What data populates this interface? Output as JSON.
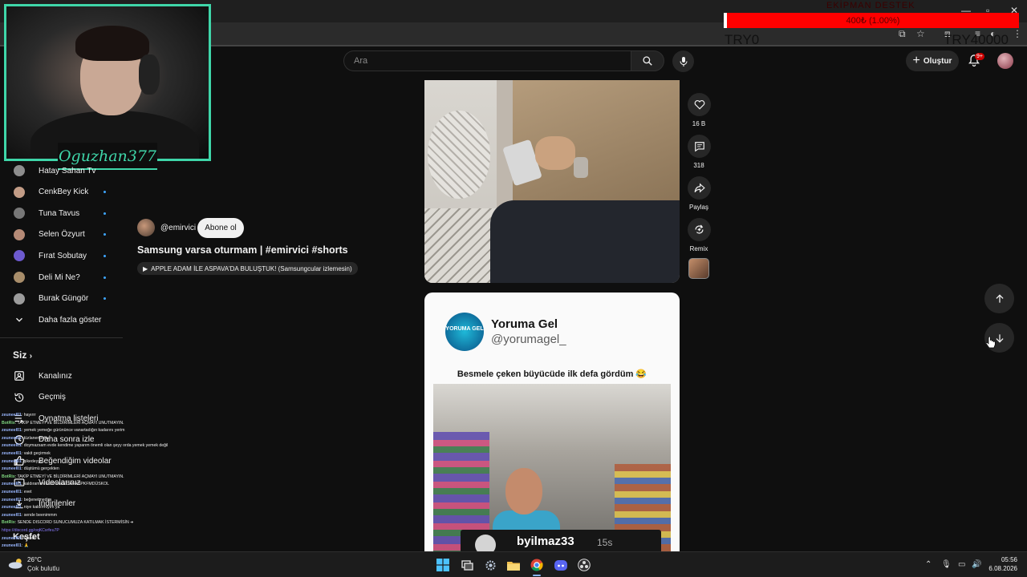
{
  "donation": {
    "title": "EKİPMAN DESTEK",
    "progress_text": "400₺ (1.00%)",
    "progress_fraction": 0.01,
    "min_label": "TRY0",
    "max_label": "TRY40000",
    "bar_color": "#ff0000"
  },
  "webcam": {
    "streamer_name": "Oguzhan377",
    "border_color": "#3fd6a9"
  },
  "header": {
    "search_placeholder": "Ara",
    "create_label": "Oluştur",
    "notification_count": "9+"
  },
  "sidebar": {
    "subscriptions": [
      {
        "label": "Hatay Sahan Tv",
        "avatar_color": "#8d8d8d"
      },
      {
        "label": "CenkBey Kick",
        "avatar_color": "#c29c86"
      },
      {
        "label": "Tuna Tavus",
        "avatar_color": "#777777"
      },
      {
        "label": "Selen Özyurt",
        "avatar_color": "#b58a76"
      },
      {
        "label": "Fırat Sobutay",
        "avatar_color": "#6d5acf"
      },
      {
        "label": "Deli Mi Ne?",
        "avatar_color": "#a88d6a"
      },
      {
        "label": "Burak Güngör",
        "avatar_color": "#9c9c9c"
      }
    ],
    "show_more_label": "Daha fazla göster",
    "you_section_label": "Siz",
    "you_items": [
      {
        "label": "Kanalınız",
        "icon": "channel-icon"
      },
      {
        "label": "Geçmiş",
        "icon": "history-icon"
      },
      {
        "label": "Oynatma listeleri",
        "icon": "playlist-icon"
      },
      {
        "label": "Daha sonra izle",
        "icon": "clock-icon"
      },
      {
        "label": "Beğendiğim videolar",
        "icon": "like-icon"
      },
      {
        "label": "Videolarınız",
        "icon": "video-icon"
      },
      {
        "label": "İndirilenler",
        "icon": "download-icon"
      }
    ],
    "explore_label": "Keşfet"
  },
  "chat": {
    "messages": [
      {
        "user": "zeuneel01",
        "text": ": hayırrr",
        "bot": false
      },
      {
        "user": "BotRix",
        "text": ": TAKİP ETMEYİ VE BİLDİRİMLERİ AÇMAYI UNUTMAYIN.",
        "bot": true
      },
      {
        "user": "zeuneel01",
        "text": ": yemek yemeğe gürününce vanartadığın kadarını yerim",
        "bot": false
      },
      {
        "user": "zeuneel01",
        "text": ": tüzlanenpuftu",
        "bot": false
      },
      {
        "user": "zeuneel01",
        "text": ": doymazsam evde kendime yaparım önemli olan şeyy orda yemek yemek değil",
        "bot": false
      },
      {
        "user": "zeuneel01",
        "text": ": vakit geçirmek",
        "bot": false
      },
      {
        "user": "zeuneel01",
        "text": ": şikedeyyy",
        "bot": false
      },
      {
        "user": "zeuneel01",
        "text": ": düştümü gerçekten",
        "bot": false
      },
      {
        "user": "BotRix",
        "text": ": TAKİP ETMEYİ VE BİLDİRİMLERİ AÇMAYI UNUTMAYIN.",
        "bot": true
      },
      {
        "user": "zeuneel01",
        "text": ": kaldıramım ki siz bana DAFAOPKFMDÜSKOL",
        "bot": false
      },
      {
        "user": "zeuneel01",
        "text": ": evet",
        "bot": false
      },
      {
        "user": "zeuneel01",
        "text": ": beğenetmedim",
        "bot": false
      },
      {
        "user": "zeuneel01",
        "text": ": niye kaldırmıyım ya",
        "bot": false
      },
      {
        "user": "zeuneel01",
        "text": ": sende beenimmm",
        "bot": false
      },
      {
        "user": "BotRix",
        "text": ": SENDE DISCORD SUNUCUMUZA KATILMAK İSTERMİSİN ➜",
        "bot": true
      },
      {
        "user": "",
        "text": "https://discord.gg/oqKCsrfeu7P",
        "bot": false,
        "link": true
      },
      {
        "user": "zeuneel01",
        "text": ": Güzel",
        "bot": false
      },
      {
        "user": "zeuneel01",
        "text": ": 🙏",
        "bot": false
      }
    ]
  },
  "video": {
    "channel_handle": "@emirvici",
    "subscribe_label": "Abone ol",
    "title": "Samsung varsa oturmam | #emirvici #shorts",
    "related_label": "APPLE ADAM İLE ASPAVA'DA BULUŞTUK! (Samsungcular izlemesin)"
  },
  "actions": {
    "likes": "16 B",
    "comments": "318",
    "share_label": "Paylaş",
    "remix_label": "Remix"
  },
  "next_short": {
    "account_name": "Yoruma Gel",
    "account_handle": "@yorumagel_",
    "logo_text": "YORUMA GEL",
    "caption": "Besmele çeken büyücüde ilk defa gördüm 😂",
    "overlay_user": "byilmaz33",
    "overlay_time": "15s"
  },
  "taskbar": {
    "temperature": "26°C",
    "weather": "Çok bulutlu",
    "time": "05:56",
    "date": "6.08.2026"
  }
}
